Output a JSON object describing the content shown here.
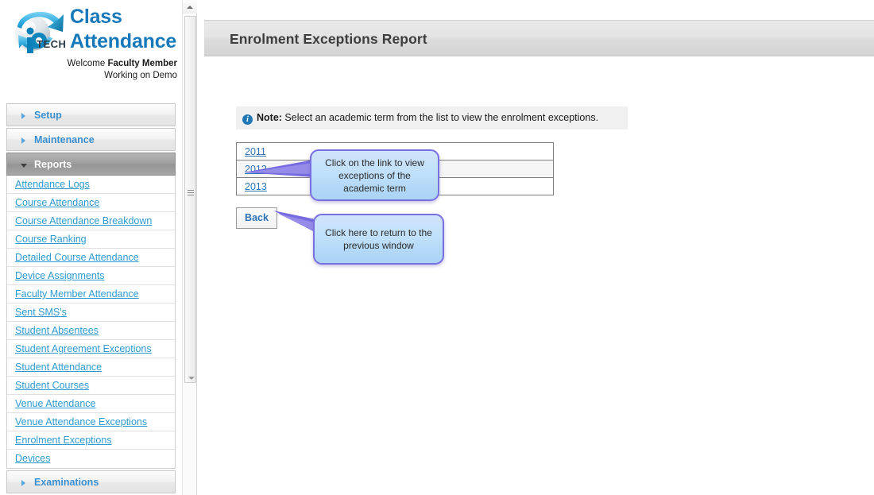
{
  "brand": {
    "logo_icon": "globe-arrow-logo",
    "logo_text": "iPTECH",
    "title_line1": "Class",
    "title_line2": "Attendance",
    "welcome_prefix": "Welcome ",
    "welcome_name": "Faculty Member",
    "welcome_line2": "Working on Demo"
  },
  "sidebar": {
    "groups": [
      {
        "label": "Setup",
        "open": false,
        "icon": "triangle-right-icon",
        "items": []
      },
      {
        "label": "Maintenance",
        "open": false,
        "icon": "triangle-right-icon",
        "items": []
      },
      {
        "label": "Reports",
        "open": true,
        "icon": "triangle-down-icon",
        "items": [
          "Attendance Logs",
          "Course Attendance",
          "Course Attendance Breakdown",
          "Course Ranking",
          "Detailed Course Attendance",
          "Device Assignments",
          "Faculty Member Attendance",
          "Sent SMS's",
          "Student Absentees",
          "Student Agreement Exceptions",
          "Student Attendance",
          "Student Courses",
          "Venue Attendance",
          "Venue Attendance Exceptions",
          "Enrolment Exceptions",
          "Devices"
        ]
      },
      {
        "label": "Examinations",
        "open": false,
        "icon": "triangle-right-icon",
        "items": []
      }
    ],
    "scrollbar": {
      "up_arrow_icon": "scroll-up-arrow-icon",
      "grip_icon": "scroll-grip-icon",
      "thumb_arrow_icon": "scroll-down-arrow-icon"
    }
  },
  "main": {
    "page_title": "Enrolment Exceptions Report",
    "note": {
      "icon": "info-circle-icon",
      "label": "Note:",
      "text": " Select an academic term from the list to view the enrolment exceptions."
    },
    "term_table": {
      "rows": [
        {
          "term": "2011"
        },
        {
          "term": "2012"
        },
        {
          "term": "2013"
        }
      ]
    },
    "back_button": "Back",
    "callouts": [
      {
        "id": "callout-term-link",
        "text": "Click on the link to view exceptions of the academic term"
      },
      {
        "id": "callout-back-button",
        "text": "Click here to return to the previous window"
      }
    ]
  },
  "colors": {
    "brand_blue": "#1779ba",
    "link_blue": "#2e9ad0",
    "accent_gray": "#9e9e9e",
    "callout_border": "#7a6fe0",
    "callout_fill": "#bfe0fb",
    "info_blue": "#2277b5"
  }
}
